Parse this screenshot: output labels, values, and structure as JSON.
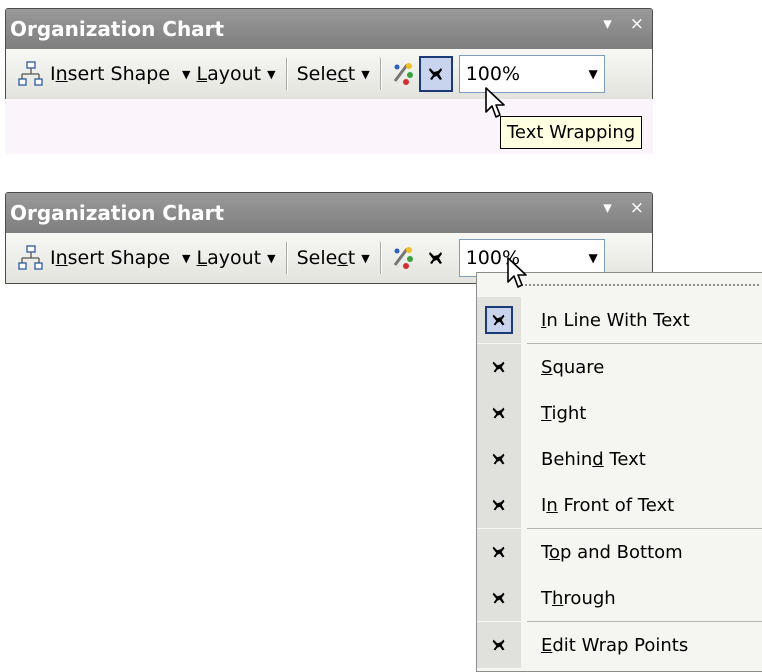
{
  "panel_top": {
    "title": "Organization Chart",
    "dropdown_glyph": "▾",
    "close_glyph": "×",
    "insert_shape_pre": "I",
    "insert_shape_ul": "n",
    "insert_shape_post": "sert Shape",
    "layout_ul": "L",
    "layout_post": "ayout",
    "select_pre": "Sele",
    "select_ul": "c",
    "select_post": "t",
    "zoom_value": "100%",
    "tooltip": "Text Wrapping"
  },
  "panel_bottom": {
    "title": "Organization Chart",
    "dropdown_glyph": "▾",
    "close_glyph": "×",
    "insert_shape_pre": "I",
    "insert_shape_ul": "n",
    "insert_shape_post": "sert Shape",
    "layout_ul": "L",
    "layout_post": "ayout",
    "select_pre": "Sele",
    "select_ul": "c",
    "select_post": "t",
    "zoom_value": "100%"
  },
  "wrap_menu": {
    "items": [
      {
        "pre": "",
        "ul": "I",
        "post": "n Line With Text",
        "checked": true
      },
      {
        "pre": "",
        "ul": "S",
        "post": "quare",
        "checked": false
      },
      {
        "pre": "",
        "ul": "T",
        "post": "ight",
        "checked": false
      },
      {
        "pre": "Behin",
        "ul": "d",
        "post": " Text",
        "checked": false
      },
      {
        "pre": "I",
        "ul": "n",
        "post": " Front of Text",
        "checked": false
      },
      {
        "pre": "T",
        "ul": "o",
        "post": "p and Bottom",
        "checked": false
      },
      {
        "pre": "T",
        "ul": "h",
        "post": "rough",
        "checked": false
      },
      {
        "pre": "",
        "ul": "E",
        "post": "dit Wrap Points",
        "checked": false
      }
    ]
  },
  "colors": {
    "title_bar": "#8a8a8a",
    "pressed_border": "#1c3a78",
    "tooltip_bg": "#ffffe1"
  }
}
